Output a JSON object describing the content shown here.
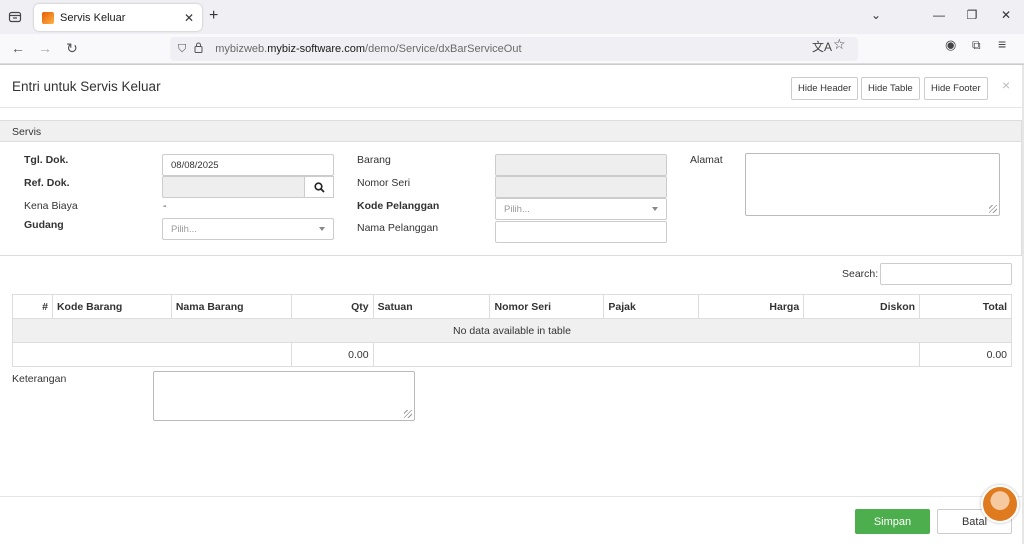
{
  "browser": {
    "tab_title": "Servis Keluar",
    "url_prefix": "mybizweb.",
    "url_host": "mybiz-software.com",
    "url_path": "/demo/Service/dxBarServiceOut"
  },
  "modal": {
    "title": "Entri untuk Servis Keluar",
    "hide_header": "Hide Header",
    "hide_table": "Hide Table",
    "hide_footer": "Hide Footer"
  },
  "panel": {
    "title": "Servis",
    "tgl_dok_label": "Tgl. Dok.",
    "tgl_dok_value": "08/08/2025",
    "ref_dok_label": "Ref. Dok.",
    "kena_biaya_label": "Kena Biaya",
    "kena_biaya_value": "-",
    "gudang_label": "Gudang",
    "gudang_placeholder": "Pilih...",
    "barang_label": "Barang",
    "nomor_seri_label": "Nomor Seri",
    "kode_pelanggan_label": "Kode Pelanggan",
    "kode_pelanggan_placeholder": "Pilih...",
    "nama_pelanggan_label": "Nama Pelanggan",
    "alamat_label": "Alamat"
  },
  "table": {
    "search_label": "Search:",
    "columns": [
      "#",
      "Kode Barang",
      "Nama Barang",
      "Qty",
      "Satuan",
      "Nomor Seri",
      "Pajak",
      "Harga",
      "Diskon",
      "Total"
    ],
    "empty_text": "No data available in table",
    "footer_qty": "0.00",
    "footer_total": "0.00"
  },
  "footer": {
    "keterangan_label": "Keterangan",
    "save_label": "Simpan",
    "cancel_label": "Batal"
  }
}
